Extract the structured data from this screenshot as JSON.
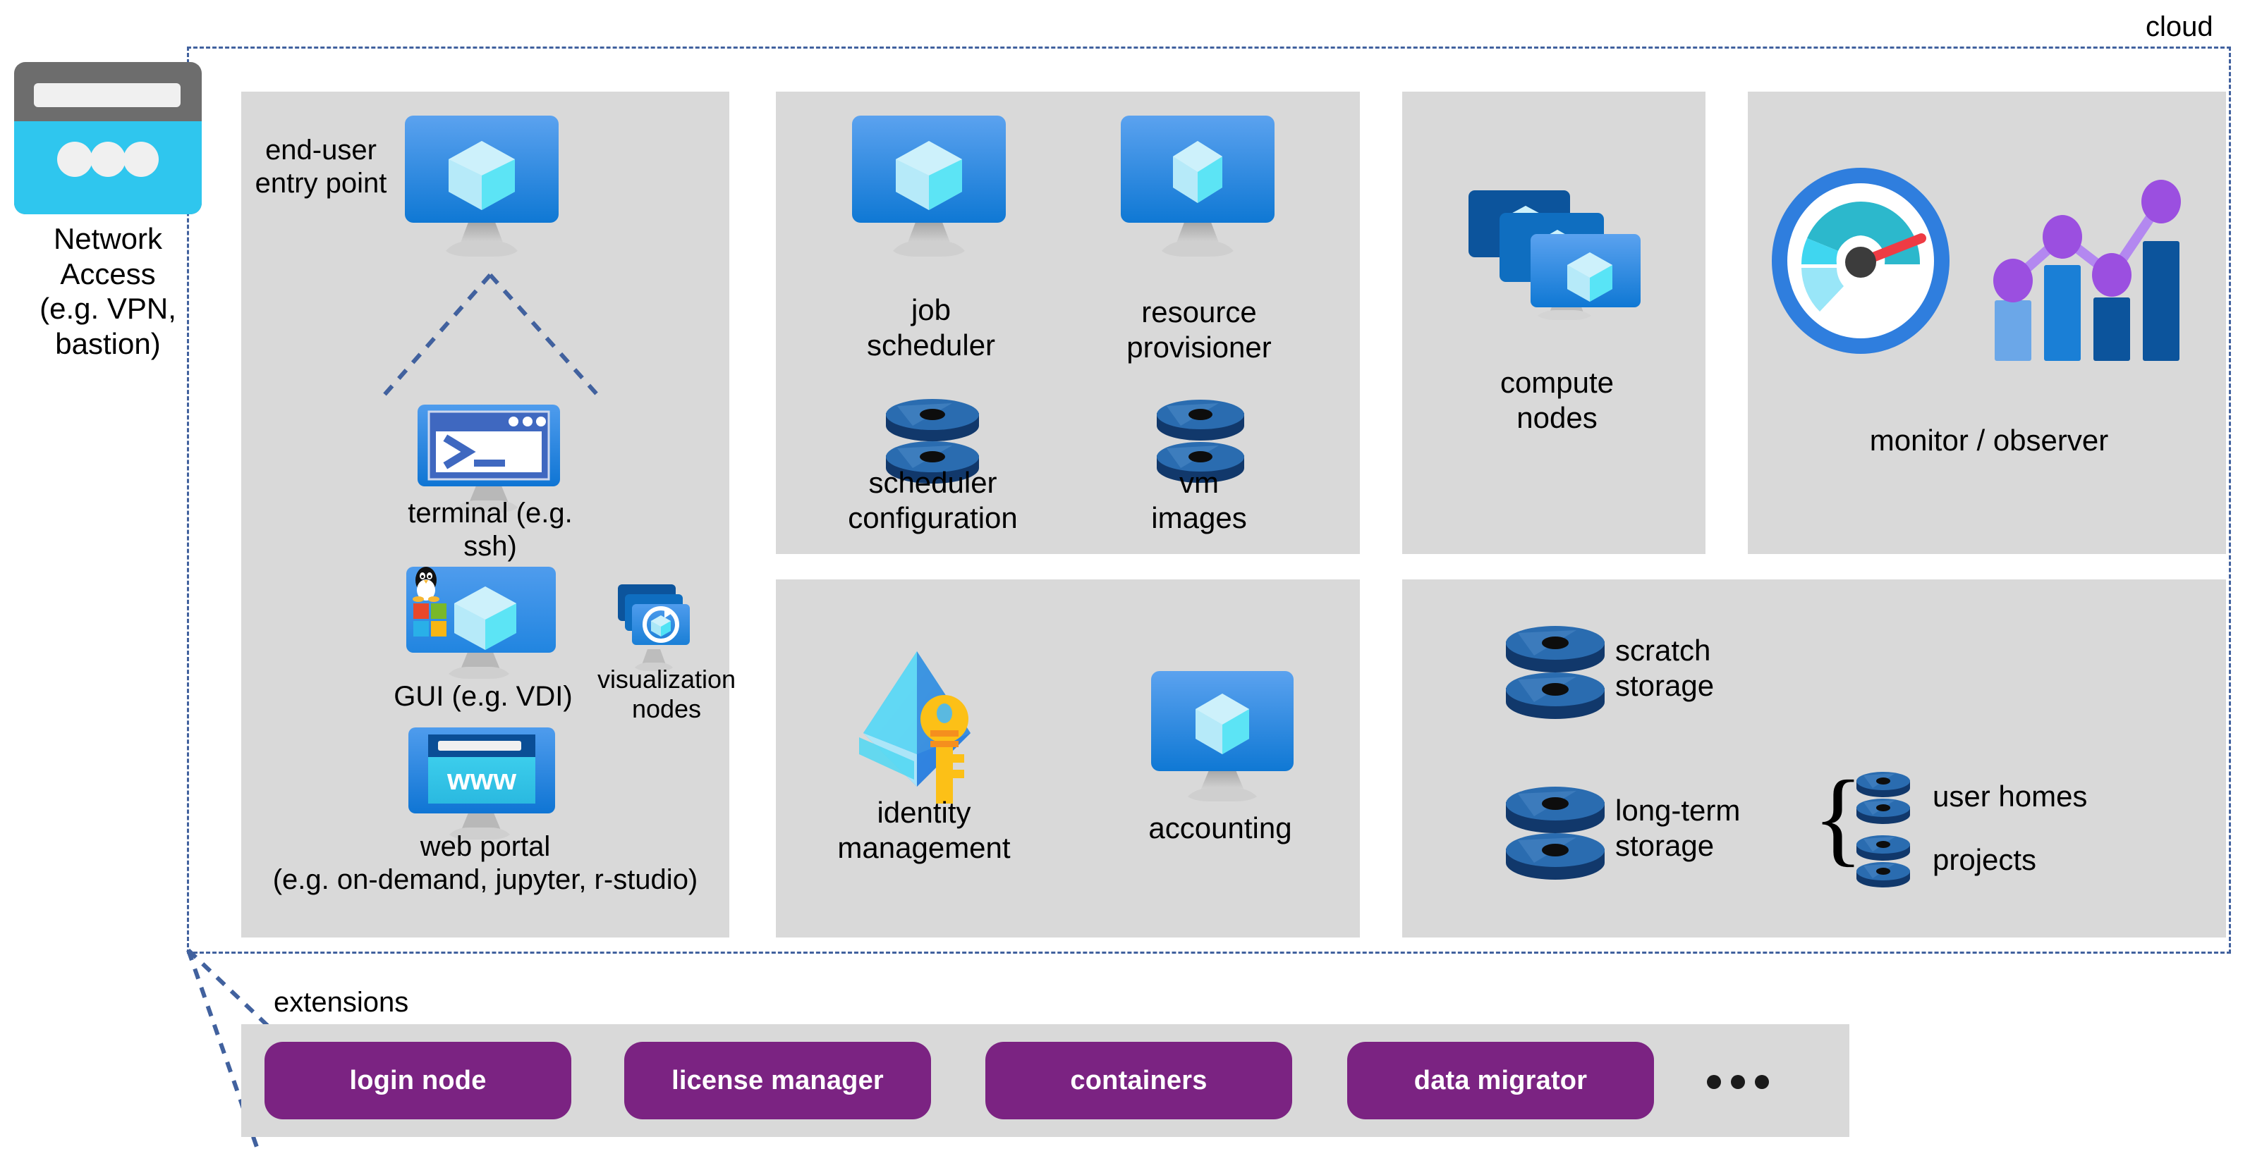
{
  "diagram": {
    "cloud_label": "cloud",
    "extensions_label": "extensions",
    "network_access_label": "Network\nAccess\n(e.g. VPN,\nbastion)",
    "colors": {
      "panel_bg": "#d9d9d9",
      "cloud_border": "#41619e",
      "extension_button": "#7b2382",
      "vm_blue_light": "#4f9ced",
      "vm_blue_dark": "#0f75d4",
      "cube_cyan": "#4fe3f5",
      "storage_blue": "#2a6cb0",
      "storage_dark": "#11386b",
      "accent_purple": "#9b4fe0",
      "gauge_red": "#ee3b44"
    }
  },
  "network_access": {
    "icon": "browser-window-icon",
    "label": "Network\nAccess\n(e.g. VPN,\nbastion)"
  },
  "panels": {
    "access": {
      "name": "access-panel",
      "items": [
        {
          "id": "end-user-entry-point",
          "icon": "vm-monitor-icon",
          "label": "end-user\nentry point"
        },
        {
          "id": "terminal",
          "icon": "terminal-icon",
          "label": "terminal (e.g. ssh)"
        },
        {
          "id": "gui-vdi",
          "icon": "gui-desktop-icon",
          "label": "GUI (e.g. VDI)"
        },
        {
          "id": "visualization-nodes",
          "icon": "viz-nodes-icon",
          "label": "visualization\nnodes"
        },
        {
          "id": "web-portal",
          "icon": "www-browser-icon",
          "label": "web portal\n(e.g. on-demand, jupyter, r-studio)"
        }
      ]
    },
    "orchestration": {
      "name": "orchestration-panel",
      "items": [
        {
          "id": "job-scheduler",
          "icon": "vm-monitor-icon",
          "label": "job\nscheduler"
        },
        {
          "id": "resource-provisioner",
          "icon": "vm-monitor-icon",
          "label": "resource\nprovisioner"
        },
        {
          "id": "scheduler-configuration",
          "icon": "database-icon",
          "label": "scheduler\nconfiguration"
        },
        {
          "id": "vm-images",
          "icon": "database-icon",
          "label": "vm\nimages"
        }
      ]
    },
    "compute": {
      "name": "compute-panel",
      "items": [
        {
          "id": "compute-nodes",
          "icon": "stacked-vm-icon",
          "label": "compute\nnodes"
        }
      ]
    },
    "monitoring": {
      "name": "monitoring-panel",
      "items": [
        {
          "id": "monitor-observer",
          "icon": "gauge-chart-icon",
          "label": "monitor / observer"
        }
      ]
    },
    "governance": {
      "name": "governance-panel",
      "items": [
        {
          "id": "identity-management",
          "icon": "identity-key-icon",
          "label": "identity\nmanagement"
        },
        {
          "id": "accounting",
          "icon": "vm-monitor-icon",
          "label": "accounting"
        }
      ]
    },
    "storage": {
      "name": "storage-panel",
      "items": [
        {
          "id": "scratch-storage",
          "icon": "database-icon",
          "label": "scratch\nstorage"
        },
        {
          "id": "long-term-storage",
          "icon": "database-icon",
          "label": "long-term\nstorage"
        },
        {
          "id": "user-homes",
          "icon": "small-database-icon",
          "label": "user homes"
        },
        {
          "id": "projects",
          "icon": "small-database-icon",
          "label": "projects"
        }
      ],
      "brace": "{"
    }
  },
  "extensions": {
    "title": "extensions",
    "buttons": [
      {
        "label": "login node"
      },
      {
        "label": "license manager"
      },
      {
        "label": "containers"
      },
      {
        "label": "data migrator"
      }
    ],
    "more_icon": "ellipsis-icon"
  }
}
